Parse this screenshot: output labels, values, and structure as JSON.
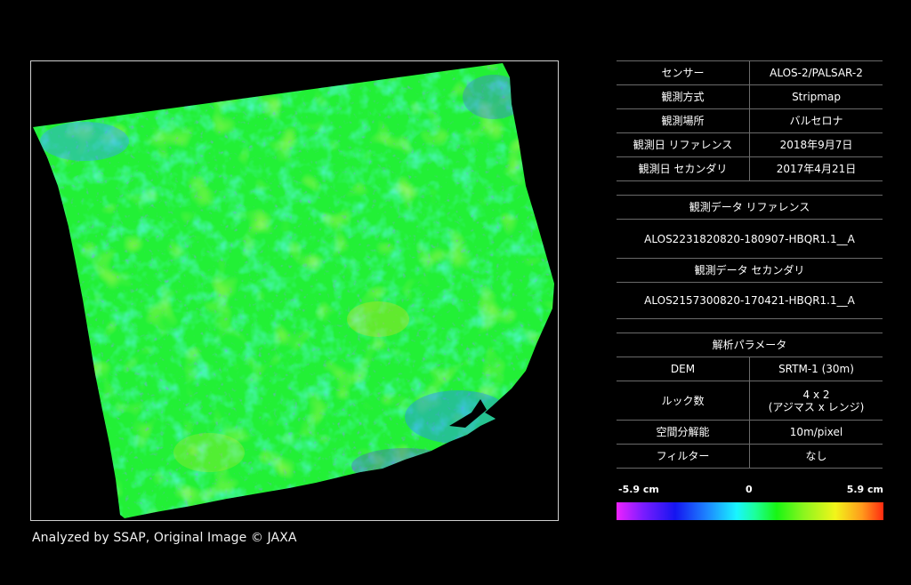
{
  "map": {
    "credit": "Analyzed by SSAP, Original Image © JAXA"
  },
  "info": {
    "sensor_label": "センサー",
    "sensor_value": "ALOS-2/PALSAR-2",
    "mode_label": "観測方式",
    "mode_value": "Stripmap",
    "location_label": "観測場所",
    "location_value": "バルセロナ",
    "ref_date_label": "観測日 リファレンス",
    "ref_date_value": "2018年9月7日",
    "sec_date_label": "観測日 セカンダリ",
    "sec_date_value": "2017年4月21日",
    "ref_data_label": "観測データ リファレンス",
    "ref_data_value": "ALOS2231820820-180907-HBQR1.1__A",
    "sec_data_label": "観測データ セカンダリ",
    "sec_data_value": "ALOS2157300820-170421-HBQR1.1__A",
    "params_label": "解析パラメータ",
    "dem_label": "DEM",
    "dem_value": "SRTM-1 (30m)",
    "looks_label": "ルック数",
    "looks_value_1": "4 x 2",
    "looks_value_2": "(アジマス x レンジ)",
    "resolution_label": "空間分解能",
    "resolution_value": "10m/pixel",
    "filter_label": "フィルター",
    "filter_value": "なし"
  },
  "scale": {
    "min_label": "-5.9 cm",
    "mid_label": "0",
    "max_label": "5.9 cm",
    "colors": [
      "#ee22ff",
      "#1515f0",
      "#19f5ff",
      "#18f513",
      "#f2f51a",
      "#ff2a10"
    ]
  }
}
